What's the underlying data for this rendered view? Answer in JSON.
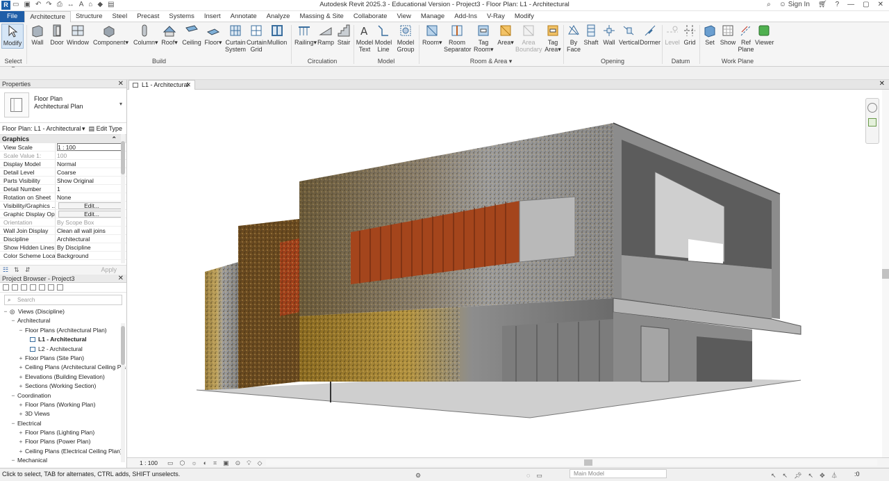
{
  "window": {
    "title": "Autodesk Revit 2025.3 - Educational Version - Project3 - Floor Plan: L1 - Architectural",
    "sign_in": "Sign In",
    "logo": "R"
  },
  "tabs": [
    "File",
    "Architecture",
    "Structure",
    "Steel",
    "Precast",
    "Systems",
    "Insert",
    "Annotate",
    "Analyze",
    "Massing & Site",
    "Collaborate",
    "View",
    "Manage",
    "Add-Ins",
    "V-Ray",
    "Modify"
  ],
  "ribbon": {
    "modify": "Modify",
    "select": "Select",
    "build": {
      "label": "Build",
      "items": [
        "Wall",
        "Door",
        "Window",
        "Component",
        "Column",
        "Roof",
        "Ceiling",
        "Floor",
        "Curtain System",
        "Curtain Grid",
        "Mullion"
      ]
    },
    "circulation": {
      "label": "Circulation",
      "items": [
        "Railing",
        "Ramp",
        "Stair"
      ]
    },
    "model": {
      "label": "Model",
      "items": [
        "Model Text",
        "Model Line",
        "Model Group"
      ]
    },
    "room_area": {
      "label": "Room & Area",
      "items": [
        "Room",
        "Room Separator",
        "Tag Room",
        "Area",
        "Area Boundary",
        "Tag Area"
      ]
    },
    "opening": {
      "label": "Opening",
      "items": [
        "By Face",
        "Shaft",
        "Wall",
        "Vertical",
        "Dormer"
      ]
    },
    "datum": {
      "label": "Datum",
      "items": [
        "Level",
        "Grid"
      ]
    },
    "work_plane": {
      "label": "Work Plane",
      "items": [
        "Set",
        "Show",
        "Ref Plane",
        "Viewer"
      ]
    }
  },
  "properties": {
    "header": "Properties",
    "type_line1": "Floor Plan",
    "type_line2": "Architectural Plan",
    "instance": "Floor Plan: L1 - Architectural",
    "edit_type": "Edit Type",
    "section": "Graphics",
    "rows": [
      {
        "k": "View Scale",
        "v": "1 : 100"
      },
      {
        "k": "Scale Value    1:",
        "v": "100"
      },
      {
        "k": "Display Model",
        "v": "Normal"
      },
      {
        "k": "Detail Level",
        "v": "Coarse"
      },
      {
        "k": "Parts Visibility",
        "v": "Show Original"
      },
      {
        "k": "Detail Number",
        "v": "1"
      },
      {
        "k": "Rotation on Sheet",
        "v": "None"
      },
      {
        "k": "Visibility/Graphics ...",
        "v": "Edit..."
      },
      {
        "k": "Graphic Display Op...",
        "v": "Edit..."
      },
      {
        "k": "Orientation",
        "v": "By Scope Box"
      },
      {
        "k": "Wall Join Display",
        "v": "Clean all wall joins"
      },
      {
        "k": "Discipline",
        "v": "Architectural"
      },
      {
        "k": "Show Hidden Lines",
        "v": "By Discipline"
      },
      {
        "k": "Color Scheme Loca...",
        "v": "Background"
      }
    ],
    "apply": "Apply"
  },
  "browser": {
    "header": "Project Browser - Project3",
    "search_placeholder": "Search",
    "nodes": [
      {
        "t": "Views (Discipline)",
        "lvl": 0,
        "tog": "−"
      },
      {
        "t": "Architectural",
        "lvl": 1,
        "tog": "−"
      },
      {
        "t": "Floor Plans (Architectural Plan)",
        "lvl": 2,
        "tog": "−"
      },
      {
        "t": "L1 - Architectural",
        "lvl": 3,
        "tog": "",
        "bold": true
      },
      {
        "t": "L2 - Architectural",
        "lvl": 3,
        "tog": ""
      },
      {
        "t": "Floor Plans (Site Plan)",
        "lvl": 2,
        "tog": "+"
      },
      {
        "t": "Ceiling Plans (Architectural Ceiling Pla",
        "lvl": 2,
        "tog": "+"
      },
      {
        "t": "Elevations (Building Elevation)",
        "lvl": 2,
        "tog": "+"
      },
      {
        "t": "Sections (Working Section)",
        "lvl": 2,
        "tog": "+"
      },
      {
        "t": "Coordination",
        "lvl": 1,
        "tog": "−"
      },
      {
        "t": "Floor Plans (Working Plan)",
        "lvl": 2,
        "tog": "+"
      },
      {
        "t": "3D Views",
        "lvl": 2,
        "tog": "+"
      },
      {
        "t": "Electrical",
        "lvl": 1,
        "tog": "−"
      },
      {
        "t": "Floor Plans (Lighting Plan)",
        "lvl": 2,
        "tog": "+"
      },
      {
        "t": "Floor Plans (Power Plan)",
        "lvl": 2,
        "tog": "+"
      },
      {
        "t": "Ceiling Plans (Electrical Ceiling Plan)",
        "lvl": 2,
        "tog": "+"
      },
      {
        "t": "Mechanical",
        "lvl": 1,
        "tog": "−"
      }
    ]
  },
  "view": {
    "tab": "L1 - Architectural",
    "scale": "1 : 100"
  },
  "status": {
    "message": "Click to select, TAB for alternates, CTRL adds, SHIFT unselects.",
    "model": "Main Model",
    "filter_count": ":0"
  },
  "colors": {
    "accent": "#1f5ea8",
    "selected": "#d6e6f6"
  }
}
